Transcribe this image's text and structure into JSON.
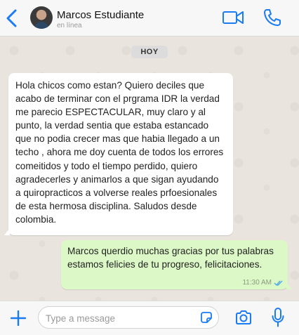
{
  "header": {
    "contact_name": "Marcos Estudiante",
    "status": "en línea",
    "icons": [
      "back-arrow-icon",
      "avatar",
      "video-call-icon",
      "phone-call-icon"
    ]
  },
  "chat": {
    "date_badge": "HOY",
    "messages": [
      {
        "direction": "incoming",
        "text": "Hola chicos como estan? Quiero deciles que acabo de terminar con el prgrama IDR la verdad me parecio ESPECTACULAR, muy claro y al punto, la verdad sentia que estaba estancado que no podia crecer mas que habia llegado a un techo , ahora me doy cuenta de todos los errores comeitidos y todo el tiempo perdido, quiero agradecerles y animarlos a que sigan ayudando a quiropracticos a volverse reales prfoesionales de esta hermosa disciplina. Saludos desde colombia."
      },
      {
        "direction": "outgoing",
        "text": "Marcos querdio muchas gracias por tus palabras estamos felicies de tu progreso, felicitaciones.",
        "time": "11:30 AM",
        "read_status": "read-double-tick"
      }
    ]
  },
  "footer": {
    "input_placeholder": "Type a message",
    "input_value": "",
    "icons": [
      "plus-icon",
      "sticker-icon",
      "camera-icon",
      "microphone-icon"
    ]
  },
  "colors": {
    "accent": "#1a7cf0",
    "chat_background": "#e9e5de",
    "outgoing_bubble": "#dcf8c6",
    "incoming_bubble": "#ffffff",
    "read_ticks": "#4fa8e6"
  }
}
